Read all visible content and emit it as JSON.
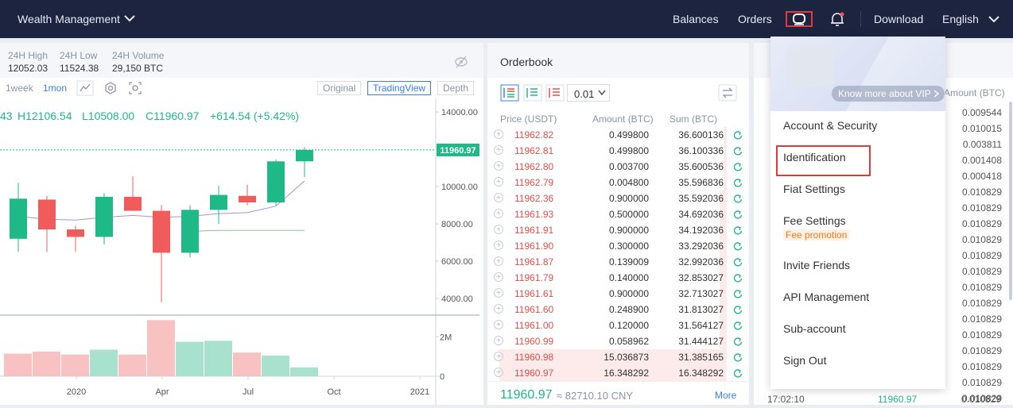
{
  "nav": {
    "wealth_label": "Wealth Management",
    "balances": "Balances",
    "orders": "Orders",
    "download": "Download",
    "language": "English",
    "bg_color": "#1c2440"
  },
  "stats": {
    "high_label": "24H High",
    "high_value": "12052.03",
    "low_label": "24H Low",
    "low_value": "11524.38",
    "volume_label": "24H Volume",
    "volume_value": "29,150 BTC"
  },
  "chart_toolbar": {
    "intervals": [
      "1week",
      "1mon"
    ],
    "active_interval": "1mon",
    "views": [
      "Original",
      "TradingView",
      "Depth"
    ],
    "active_view": "TradingView"
  },
  "ohlc": {
    "open_fragment": "43",
    "high": "H12106.54",
    "low": "L10508.00",
    "close": "C11960.97",
    "change": "+614.54 (+5.42%)"
  },
  "chart_data": {
    "type": "candlestick",
    "x_tick_labels": [
      "2020",
      "Apr",
      "Jul",
      "Oct",
      "2021"
    ],
    "y_tick_labels": [
      "14000.00",
      "12000.00",
      "10000.00",
      "8000.00",
      "6000.00",
      "4000.00"
    ],
    "last_price_label": "11960.97",
    "volume_tick_labels": [
      "2M",
      "0"
    ],
    "ylim": [
      3500,
      14500
    ],
    "up_color": "#1fb887",
    "down_color": "#f05c5c",
    "candles": [
      {
        "open": 7200,
        "high": 10200,
        "low": 6500,
        "close": 9350
      },
      {
        "open": 9300,
        "high": 9500,
        "low": 6500,
        "close": 7700
      },
      {
        "open": 7700,
        "high": 7900,
        "low": 6500,
        "close": 7300
      },
      {
        "open": 7300,
        "high": 9650,
        "low": 6900,
        "close": 9450
      },
      {
        "open": 9450,
        "high": 10550,
        "low": 8900,
        "close": 8700
      },
      {
        "open": 8700,
        "high": 9000,
        "low": 3800,
        "close": 6450
      },
      {
        "open": 6450,
        "high": 9000,
        "low": 6200,
        "close": 8750
      },
      {
        "open": 8750,
        "high": 10050,
        "low": 8000,
        "close": 9550
      },
      {
        "open": 9500,
        "high": 10100,
        "low": 9000,
        "close": 9150
      },
      {
        "open": 9150,
        "high": 11450,
        "low": 9000,
        "close": 11350
      },
      {
        "open": 11350,
        "high": 12106.54,
        "low": 10508,
        "close": 11960.97
      }
    ],
    "ma_series": [
      {
        "values": [
          8400,
          8250,
          8200,
          8350,
          8450,
          8350,
          8400,
          8550,
          8600,
          8950,
          10300
        ],
        "color": "#a792d6"
      },
      {
        "values": [
          null,
          null,
          null,
          null,
          null,
          null,
          7600,
          7650,
          7650,
          7650,
          7650
        ],
        "color": "#8bc58b"
      }
    ],
    "volume_ylim": [
      0,
      2900000
    ],
    "volumes": [
      {
        "value": 1150000,
        "up": false
      },
      {
        "value": 1250000,
        "up": false
      },
      {
        "value": 1100000,
        "up": false
      },
      {
        "value": 1350000,
        "up": true
      },
      {
        "value": 1100000,
        "up": false
      },
      {
        "value": 2850000,
        "up": false
      },
      {
        "value": 1750000,
        "up": true
      },
      {
        "value": 1800000,
        "up": true
      },
      {
        "value": 1200000,
        "up": false
      },
      {
        "value": 1050000,
        "up": true
      },
      {
        "value": 450000,
        "up": true
      }
    ]
  },
  "orderbook": {
    "title": "Orderbook",
    "precision": "0.01",
    "headers": {
      "price": "Price (USDT)",
      "amount": "Amount (BTC)",
      "sum": "Sum (BTC)"
    },
    "rows": [
      {
        "price": "11962.82",
        "amount": "0.499800",
        "sum": "36.600136",
        "depth": 0.01
      },
      {
        "price": "11962.81",
        "amount": "0.499800",
        "sum": "36.100336",
        "depth": 0.01
      },
      {
        "price": "11962.80",
        "amount": "0.003700",
        "sum": "35.600536",
        "depth": 0.01
      },
      {
        "price": "11962.79",
        "amount": "0.004800",
        "sum": "35.596836",
        "depth": 0.01
      },
      {
        "price": "11962.36",
        "amount": "0.900000",
        "sum": "35.592036",
        "depth": 0.03
      },
      {
        "price": "11961.93",
        "amount": "0.500000",
        "sum": "34.692036",
        "depth": 0.03
      },
      {
        "price": "11961.91",
        "amount": "0.900000",
        "sum": "34.192036",
        "depth": 0.03
      },
      {
        "price": "11961.90",
        "amount": "0.300000",
        "sum": "33.292036",
        "depth": 0.03
      },
      {
        "price": "11961.87",
        "amount": "0.139009",
        "sum": "32.992036",
        "depth": 0.03
      },
      {
        "price": "11961.79",
        "amount": "0.140000",
        "sum": "32.853027",
        "depth": 0.03
      },
      {
        "price": "11961.61",
        "amount": "0.900000",
        "sum": "32.713027",
        "depth": 0.03
      },
      {
        "price": "11961.60",
        "amount": "0.248900",
        "sum": "31.813027",
        "depth": 0.03
      },
      {
        "price": "11961.00",
        "amount": "0.120000",
        "sum": "31.564127",
        "depth": 0.03
      },
      {
        "price": "11960.99",
        "amount": "0.058962",
        "sum": "31.444127",
        "depth": 0.03
      },
      {
        "price": "11960.98",
        "amount": "15.036873",
        "sum": "31.385165",
        "depth": 0.95
      },
      {
        "price": "11960.97",
        "amount": "16.348292",
        "sum": "16.348292",
        "depth": 0.95
      }
    ],
    "last_price": "11960.97",
    "cny_value": "≈ 82710.10 CNY",
    "more": "More"
  },
  "market_trades": {
    "header_amount": "Amount (BTC)",
    "amounts": [
      "0.009544",
      "0.010015",
      "0.003811",
      "0.001408",
      "0.000418",
      "0.010829",
      "0.010829",
      "0.010829",
      "0.010829",
      "0.010829",
      "0.010829",
      "0.010829",
      "0.010829",
      "0.010829",
      "0.010829",
      "0.010829",
      "0.010829",
      "0.010829",
      "0.010829"
    ],
    "last_time": "17:02:10",
    "last_price": "11960.97",
    "last_amount": "0.010829"
  },
  "user_menu": {
    "vip_link": "Know more about VIP",
    "items": [
      {
        "label": "Account & Security"
      },
      {
        "label": "Identification"
      },
      {
        "label": "Fiat Settings"
      },
      {
        "label": "Fee Settings",
        "badge": "Fee promotion"
      },
      {
        "label": "Invite Friends"
      },
      {
        "label": "API Management"
      },
      {
        "label": "Sub-account"
      },
      {
        "label": "Sign Out"
      }
    ]
  },
  "colors": {
    "up": "#1fb887",
    "down": "#e2504c",
    "accent": "#3b7ee3",
    "highlight": "#e03a3a"
  }
}
